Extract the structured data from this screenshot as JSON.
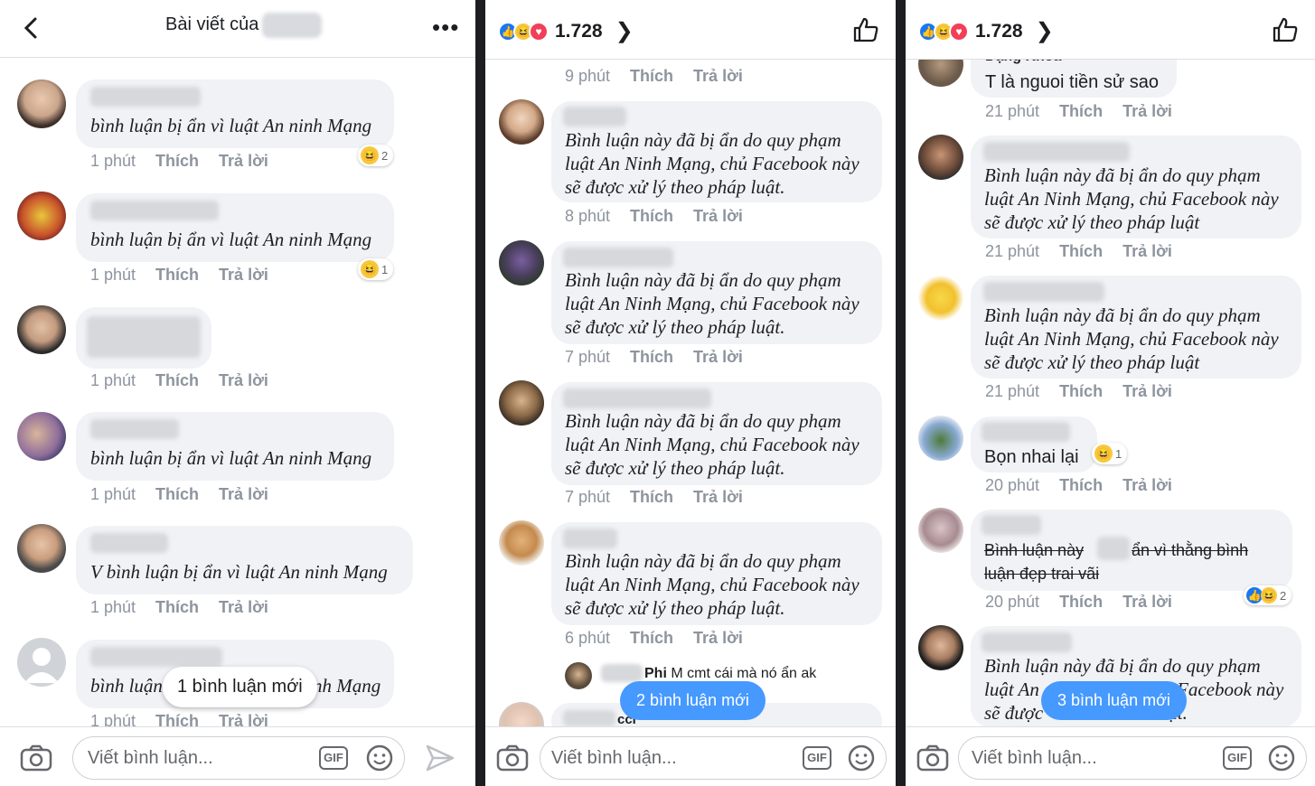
{
  "panel1": {
    "title": "Bài viết của",
    "comments": [
      {
        "text": "bình luận bị ẩn vì luật An ninh Mạng",
        "time": "1 phút",
        "like": "Thích",
        "reply": "Trả lời",
        "reaction_count": "2"
      },
      {
        "text": "bình luận bị ẩn vì luật An ninh Mạng",
        "time": "1 phút",
        "like": "Thích",
        "reply": "Trả lời",
        "reaction_count": "1"
      },
      {
        "text": "",
        "time": "1 phút",
        "like": "Thích",
        "reply": "Trả lời"
      },
      {
        "text": "bình luận bị ẩn vì luật An ninh Mạng",
        "time": "1 phút",
        "like": "Thích",
        "reply": "Trả lời"
      },
      {
        "text": "V bình luận bị ẩn vì luật An ninh Mạng",
        "time": "1 phút",
        "like": "Thích",
        "reply": "Trả lời"
      },
      {
        "text_left": "bình luận",
        "text_right": "nh Mạng",
        "time": "1 phút",
        "like": "Thích",
        "reply": "Trả lời"
      }
    ],
    "new_comments": "1 bình luận mới",
    "composer_placeholder": "Viết bình luận...",
    "gif_label": "GIF"
  },
  "panel2": {
    "reaction_count": "1.728",
    "top_meta": {
      "time": "9 phút",
      "like": "Thích",
      "reply": "Trả lời"
    },
    "comments": [
      {
        "line1": "Bình luận này đã bị ẩn do quy phạm",
        "line2": "luật An Ninh Mạng, chủ Facebook này",
        "line3": "sẽ được xử lý theo pháp luật.",
        "time": "8 phút",
        "like": "Thích",
        "reply": "Trả lời"
      },
      {
        "line1": "Bình luận này đã bị ẩn do quy phạm",
        "line2": "luật An Ninh Mạng, chủ Facebook này",
        "line3": "sẽ được xử lý theo pháp luật.",
        "time": "7 phút",
        "like": "Thích",
        "reply": "Trả lời"
      },
      {
        "line1": "Bình luận này đã bị ẩn do quy phạm",
        "line2": "luật An Ninh Mạng, chủ Facebook này",
        "line3": "sẽ được xử lý theo pháp luật.",
        "time": "7 phút",
        "like": "Thích",
        "reply": "Trả lời"
      },
      {
        "line1": "Bình luận này đã bị ẩn do quy phạm",
        "line2": "luật An Ninh Mạng, chủ Facebook này",
        "line3": "sẽ được xử lý theo pháp luật.",
        "time": "6 phút",
        "like": "Thích",
        "reply": "Trả lời"
      }
    ],
    "reply_preview": {
      "name": "Phi",
      "text": "M cmt cái mà nó ẩn ak"
    },
    "partial_text": "cci",
    "new_comments": "2 bình luận mới",
    "composer_placeholder": "Viết bình luận...",
    "gif_label": "GIF"
  },
  "panel3": {
    "reaction_count": "1.728",
    "comments": [
      {
        "name": "Đặng Khoa",
        "text": "T là nguoi tiền sử sao",
        "time": "21 phút",
        "like": "Thích",
        "reply": "Trả lời"
      },
      {
        "line1": "Bình luận này đã bị ẩn do quy phạm",
        "line2": "luật An Ninh Mạng, chủ Facebook này",
        "line3": "sẽ được xử lý theo pháp luật",
        "time": "21 phút",
        "like": "Thích",
        "reply": "Trả lời"
      },
      {
        "line1": "Bình luận này đã bị ẩn do quy phạm",
        "line2": "luật An Ninh Mạng, chủ Facebook này",
        "line3": "sẽ được xử lý theo pháp luật",
        "time": "21 phút",
        "like": "Thích",
        "reply": "Trả lời"
      },
      {
        "text": "Bọn nhai lại",
        "time": "20 phút",
        "like": "Thích",
        "reply": "Trả lời",
        "reaction_count": "1"
      },
      {
        "line1a": "Bình luận này",
        "line1b": "ẩn vì thằng bình",
        "line2": "luận đẹp trai vãi",
        "time": "20 phút",
        "like": "Thích",
        "reply": "Trả lời",
        "reaction_count": "2"
      },
      {
        "line1": "Bình luận này đã bị ẩn do quy phạm",
        "line2a": "luật An",
        "line2b": "Facebook này",
        "line3a": "sẽ được",
        "line3b": "luật.",
        "time": "",
        "like": "",
        "reply": ""
      }
    ],
    "new_comments": "3 bình luận mới",
    "composer_placeholder": "Viết bình luận...",
    "gif_label": "GIF"
  }
}
